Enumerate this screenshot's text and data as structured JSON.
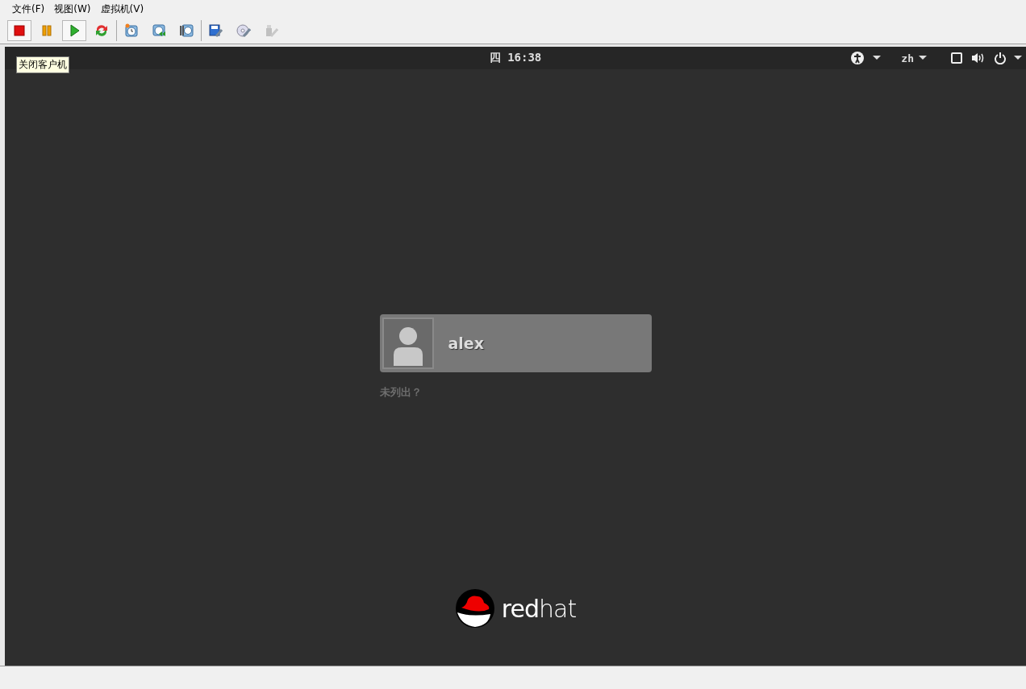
{
  "menu": [
    {
      "label": "文件(F)"
    },
    {
      "label": "视图(W)"
    },
    {
      "label": "虚拟机(V)"
    }
  ],
  "toolbar": [
    {
      "kind": "stop",
      "pressed": true,
      "disabled": false
    },
    {
      "kind": "pause",
      "pressed": false,
      "disabled": false
    },
    {
      "kind": "play",
      "pressed": true,
      "disabled": false
    },
    {
      "kind": "refresh",
      "pressed": false,
      "disabled": false
    },
    {
      "kind": "separator"
    },
    {
      "kind": "snapshot",
      "pressed": false,
      "disabled": false
    },
    {
      "kind": "revert",
      "pressed": false,
      "disabled": false
    },
    {
      "kind": "manage",
      "pressed": false,
      "disabled": false
    },
    {
      "kind": "separator"
    },
    {
      "kind": "settings",
      "pressed": false,
      "disabled": false
    },
    {
      "kind": "disc",
      "pressed": false,
      "disabled": false
    },
    {
      "kind": "usb",
      "pressed": false,
      "disabled": true
    }
  ],
  "tooltip": "关闭客户机",
  "top_bar": {
    "clock": "四 16:38",
    "language": "zh"
  },
  "login": {
    "user": "alex",
    "not_listed": "未列出？"
  },
  "logo": {
    "text": "**red**hat"
  }
}
